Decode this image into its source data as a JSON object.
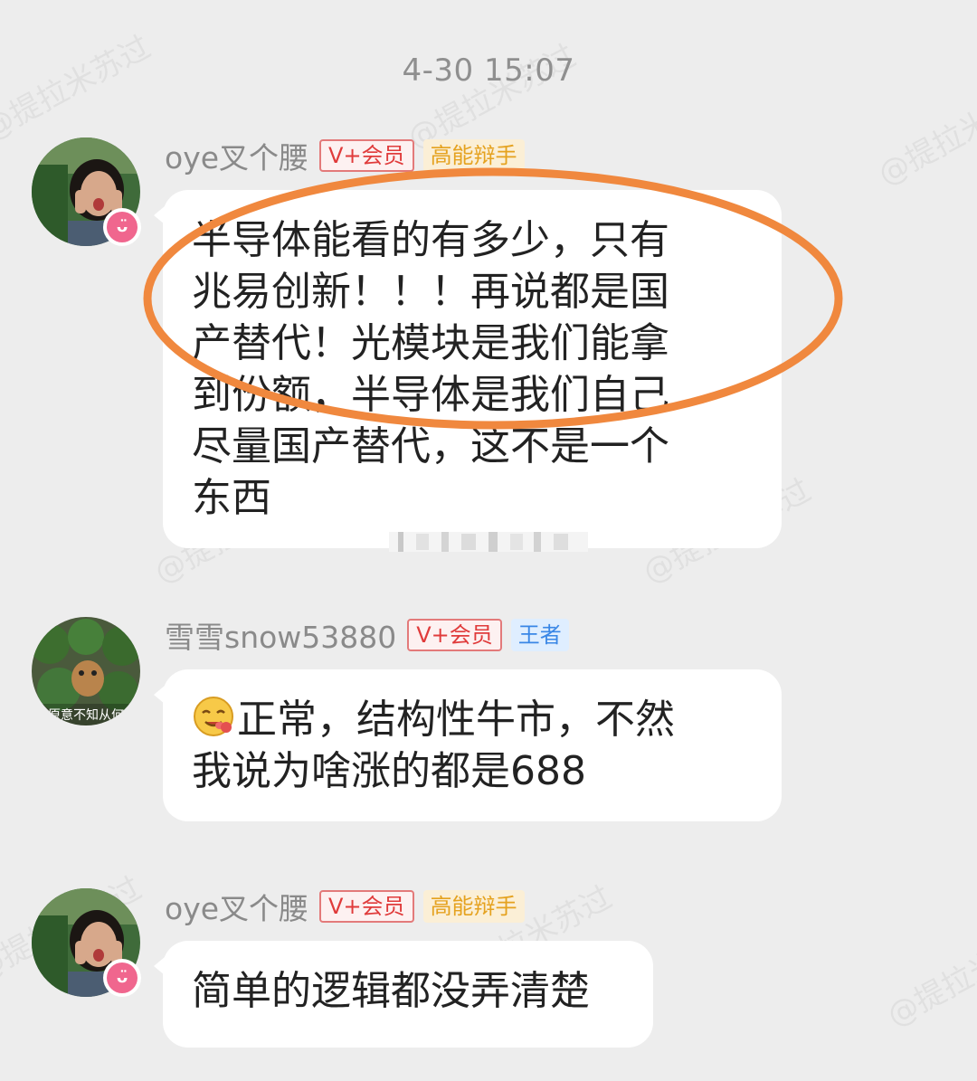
{
  "timestamp": "4-30 15:07",
  "watermark": "@提拉米苏过",
  "messages": [
    {
      "user": "oye叉个腰",
      "badges": [
        "V+会员",
        "高能辩手"
      ],
      "lines": [
        "半导体能看的有多少，只有",
        "兆易创新！！！再说都是国",
        "产替代！光模块是我们能拿",
        "到份额，半导体是我们自己",
        "尽量国产替代，这不是一个",
        "东西"
      ]
    },
    {
      "user": "雪雪snow53880",
      "badges": [
        "V+会员",
        "王者"
      ],
      "avatar_caption": "原意不知从何",
      "lines": [
        "正常，结构性牛市，不然",
        "我说为啥涨的都是688"
      ]
    },
    {
      "user": "oye叉个腰",
      "badges": [
        "V+会员",
        "高能辩手"
      ],
      "lines": [
        "简单的逻辑都没弄清楚"
      ]
    }
  ],
  "colors": {
    "background": "#ededed",
    "bubble": "#ffffff",
    "highlight_ring": "#f0883e",
    "vip_badge": "#e03b3b",
    "gold_badge": "#e5a21f",
    "blue_badge": "#3a87e6",
    "username": "#8a8a8a"
  },
  "icons": {
    "vip_dot": "rabbit-ear-icon",
    "emoji": "yum-emoji-icon"
  }
}
